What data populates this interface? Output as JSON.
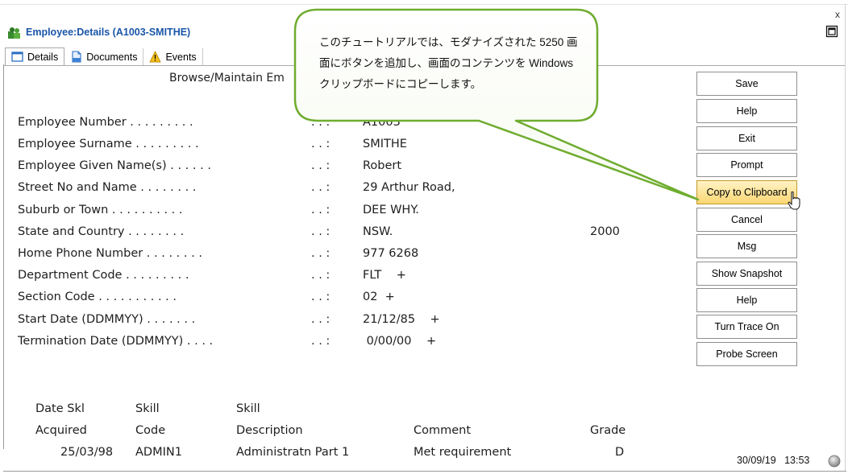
{
  "window": {
    "title": "Employee:Details (A1003-SMITHE)",
    "close_label": "x"
  },
  "tabs": [
    {
      "label": "Details",
      "icon": "window-icon",
      "active": true
    },
    {
      "label": "Documents",
      "icon": "document-icon",
      "active": false
    },
    {
      "label": "Events",
      "icon": "warning-icon",
      "active": false
    }
  ],
  "screen": {
    "title": "Browse/Maintain Em",
    "fields": [
      {
        "label": "Employee Number . . . . . . . . .",
        "sep": ". . :",
        "value": "A1003"
      },
      {
        "label": "Employee Surname . . . . . . . . .",
        "sep": ". . :",
        "value": "SMITHE"
      },
      {
        "label": "Employee Given Name(s) . . . . . .",
        "sep": ". . :",
        "value": "Robert"
      },
      {
        "label": "Street No and Name . . . . . . . .",
        "sep": ". . :",
        "value": "29 Arthur Road,"
      },
      {
        "label": "Suburb or Town . . . . . . . . . .",
        "sep": ". . :",
        "value": "DEE WHY."
      },
      {
        "label": "State and Country  . . . . . . . .",
        "sep": ". . :",
        "value": "NSW.",
        "value2": "2000"
      },
      {
        "label": "Home Phone Number  . . . . . . . .",
        "sep": ". . :",
        "value": "977 6268"
      },
      {
        "label": "Department Code  . . . . . . . . .",
        "sep": ". . :",
        "value": "FLT    +"
      },
      {
        "label": "Section Code . . . . . . . . . . .",
        "sep": ". . :",
        "value": "02  +"
      },
      {
        "label": "Start Date (DDMMYY)  . . . . . . .",
        "sep": ". . :",
        "value": "21/12/85    +"
      },
      {
        "label": "Termination Date (DDMMYY)  . . . .",
        "sep": ". . :",
        "value": " 0/00/00    +"
      }
    ]
  },
  "skills_table": {
    "header_row1": [
      "Date Skl",
      "Skill",
      "Skill",
      "",
      ""
    ],
    "header_row2": [
      "Acquired",
      "Code",
      "Description",
      "Comment",
      "Grade"
    ],
    "rows": [
      [
        "25/03/98",
        "ADMIN1",
        "Administratn Part 1",
        "Met requirement",
        "D"
      ]
    ]
  },
  "buttons": [
    {
      "label": "Save"
    },
    {
      "label": "Help"
    },
    {
      "label": "Exit"
    },
    {
      "label": "Prompt"
    },
    {
      "label": "Copy to Clipboard",
      "hovered": true
    },
    {
      "label": "Cancel"
    },
    {
      "label": "Msg"
    },
    {
      "label": "Show Snapshot"
    },
    {
      "label": "Help"
    },
    {
      "label": "Turn Trace On"
    },
    {
      "label": "Probe Screen"
    }
  ],
  "status": {
    "date": "30/09/19",
    "time": "13:53"
  },
  "callout": {
    "lines": [
      "このチュートリアルでは、モダナイズされた 5250 画",
      "面にボタンを追加し、画面のコンテンツを Windows",
      "クリップボードにコピーします。"
    ]
  },
  "colors": {
    "title": "#1a55a8",
    "callout_border": "#6fac2f",
    "hover_button": "#fbd773"
  }
}
